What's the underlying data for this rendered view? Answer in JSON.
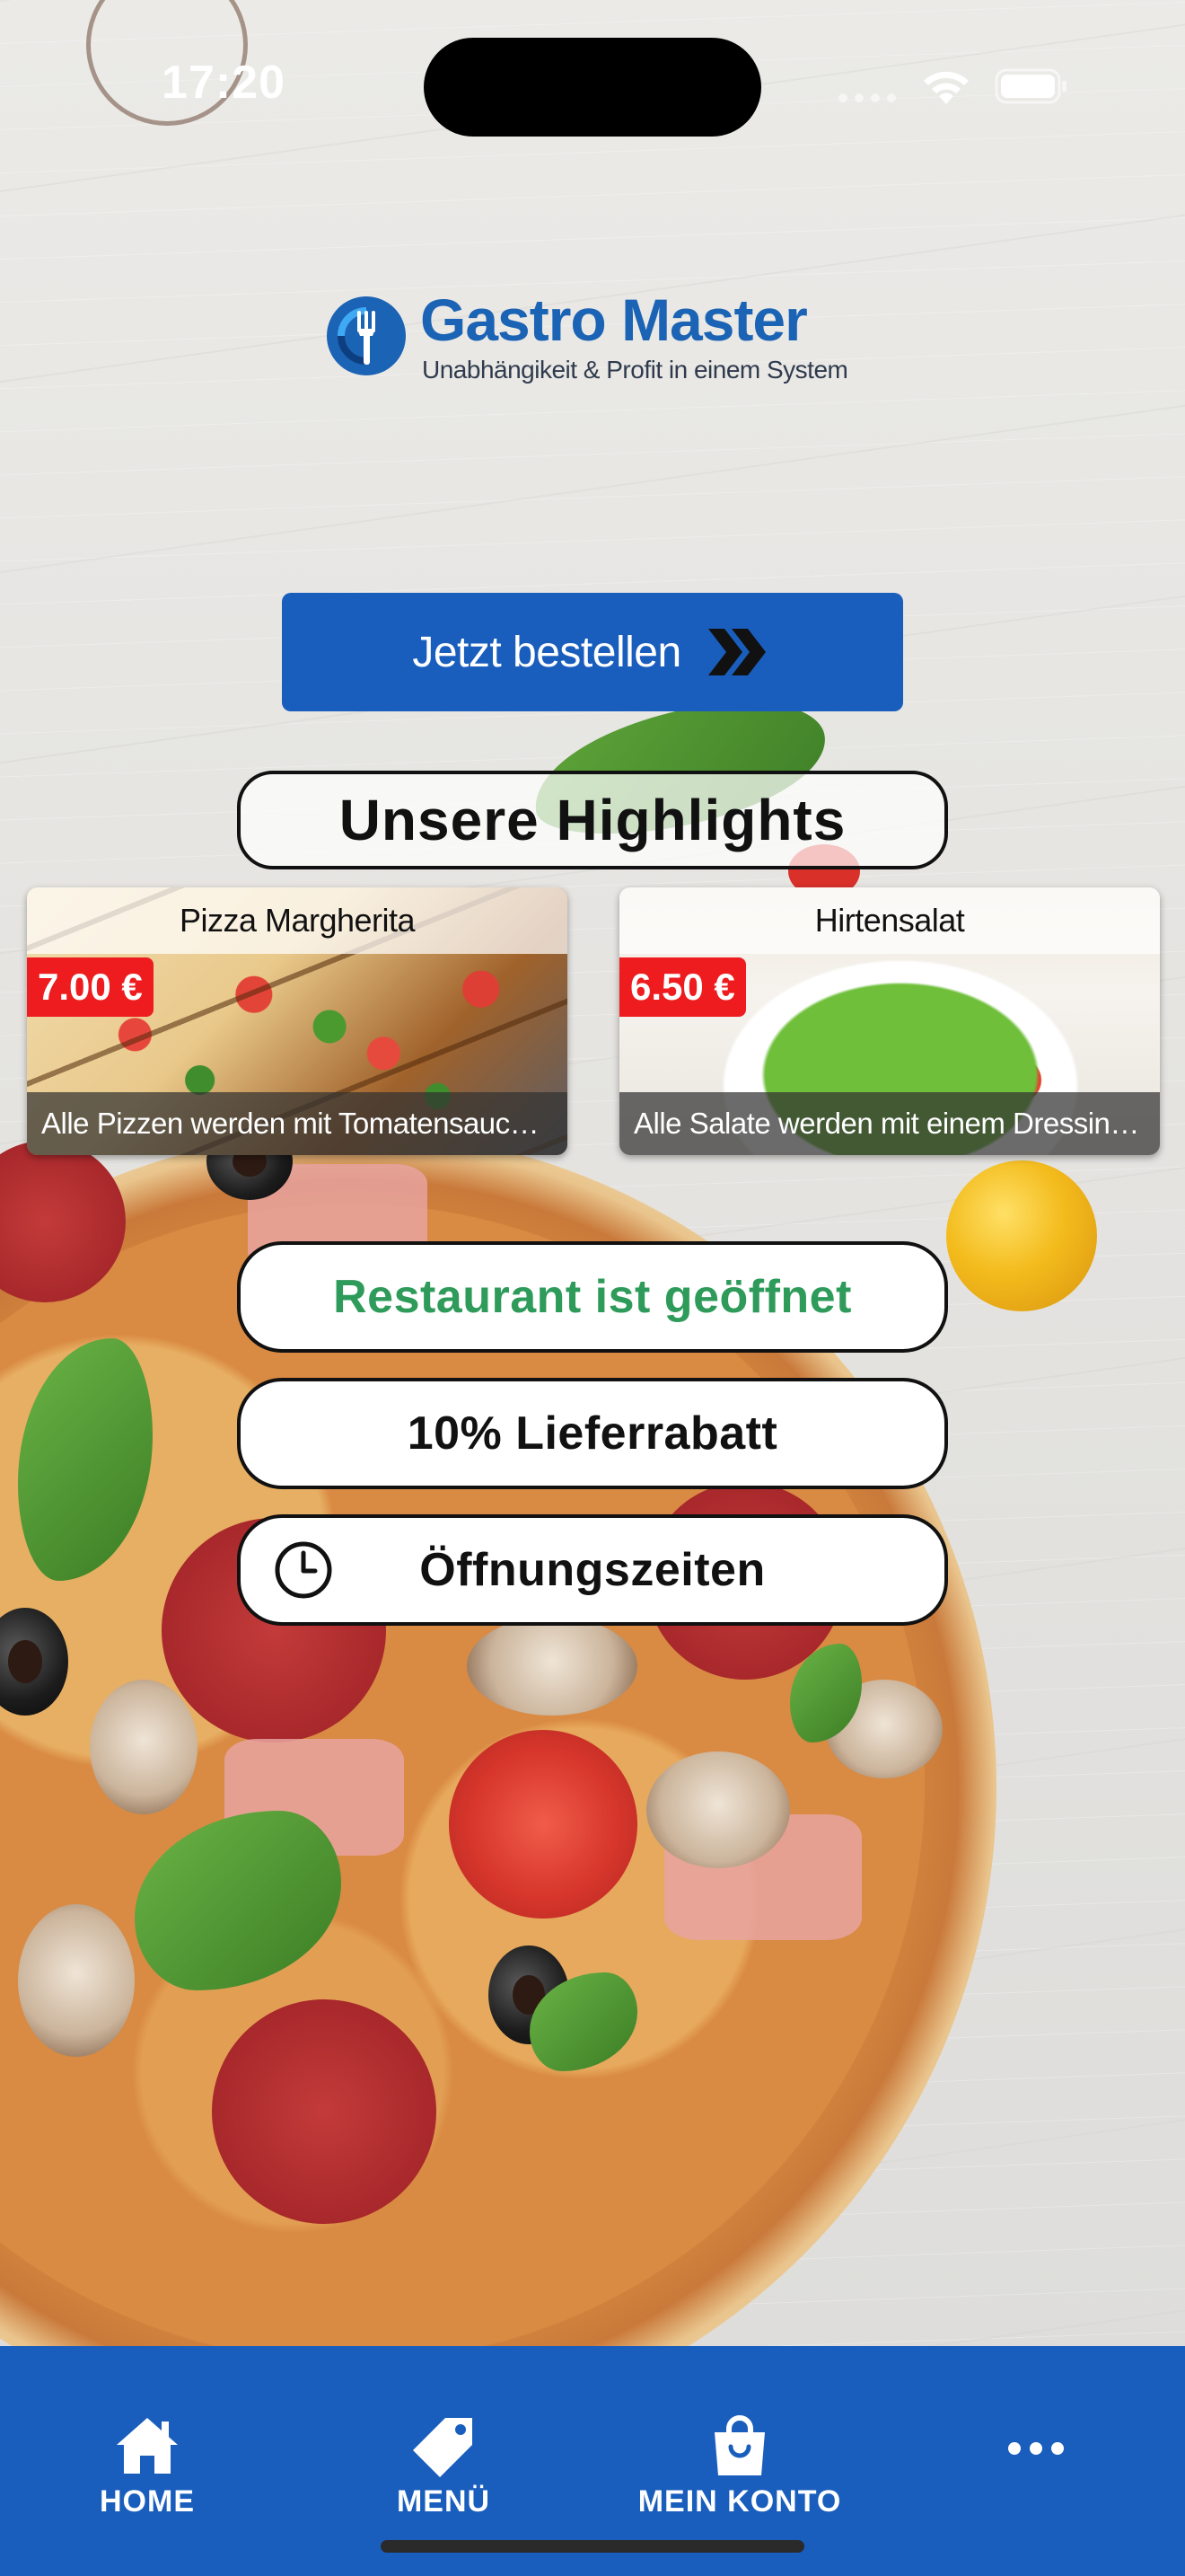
{
  "status_bar": {
    "time": "17:20"
  },
  "logo": {
    "title": "Gastro Master",
    "subtitle": "Unabhängikeit & Profit in einem System"
  },
  "order_button": {
    "label": "Jetzt bestellen",
    "icon": "double-chevron-right-icon"
  },
  "highlights": {
    "title": "Unsere Highlights",
    "items": [
      {
        "name": "Pizza Margherita",
        "price": "7.00 €",
        "description": "Alle Pizzen werden mit Tomatensauce und ..."
      },
      {
        "name": "Hirtensalat",
        "price": "6.50 €",
        "description": "Alle Salate werden mit einem Dressing nac..."
      }
    ]
  },
  "status_pills": {
    "open_status": "Restaurant ist geöffnet",
    "discount": "10% Lieferrabatt",
    "hours": "Öffnungszeiten"
  },
  "tab_bar": {
    "items": [
      {
        "label": "HOME",
        "icon": "house-icon"
      },
      {
        "label": "MENÜ",
        "icon": "tag-icon"
      },
      {
        "label": "MEIN KONTO",
        "icon": "shopping-bag-icon"
      },
      {
        "label": "",
        "icon": "more-dots-icon"
      }
    ]
  },
  "colors": {
    "brand_blue": "#1a5ebd",
    "price_red": "#ee1b1f",
    "open_green": "#2e9b5a"
  }
}
